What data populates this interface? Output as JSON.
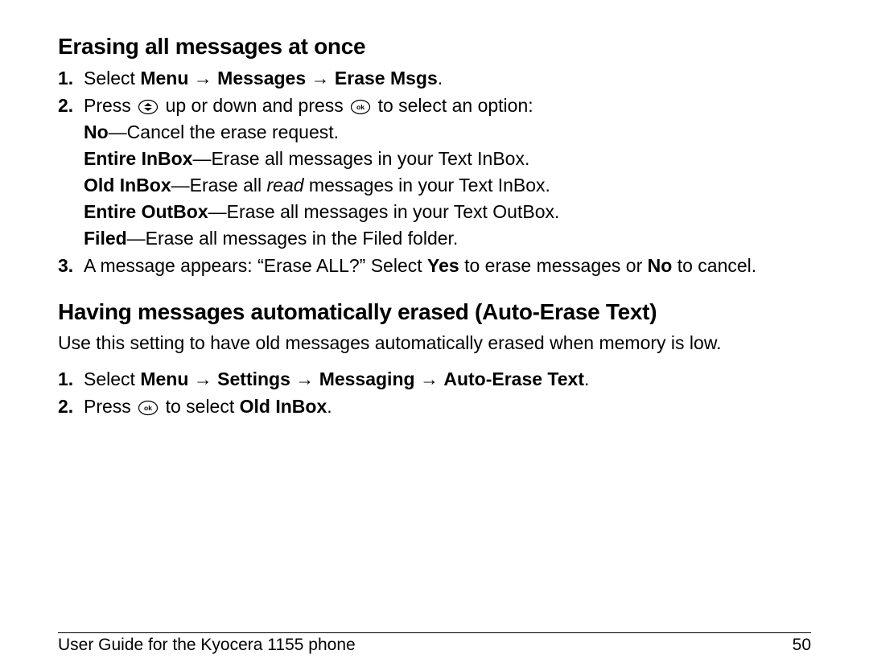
{
  "section1": {
    "heading": "Erasing all messages at once",
    "step1": {
      "num": "1.",
      "select": "Select ",
      "menu": "Menu",
      "arrow": " → ",
      "messages": "Messages",
      "erase": "Erase Msgs",
      "dot": "."
    },
    "step2": {
      "num": "2.",
      "press1": "Press ",
      "mid1": " up or down and press ",
      "mid2": " to select an option:",
      "opts": {
        "no": {
          "b": "No",
          "rest": "—Cancel the erase request."
        },
        "ei": {
          "b": "Entire InBox",
          "rest": "—Erase all messages in your Text InBox."
        },
        "oi": {
          "b": "Old InBox",
          "pre": "—Erase all ",
          "ital": "read",
          "post": " messages in your Text InBox."
        },
        "eo": {
          "b": "Entire OutBox",
          "rest": "—Erase all messages in your Text OutBox."
        },
        "fi": {
          "b": "Filed",
          "rest": "—Erase all messages in the Filed folder."
        }
      }
    },
    "step3": {
      "num": "3.",
      "a": "A message appears: “Erase ALL?” Select ",
      "yes": "Yes",
      "b": " to erase messages or ",
      "no": "No",
      "c": " to cancel."
    }
  },
  "section2": {
    "heading": "Having messages automatically erased (Auto-Erase Text)",
    "intro": "Use this setting to have old messages automatically erased when memory is low.",
    "step1": {
      "num": "1.",
      "select": "Select ",
      "menu": "Menu",
      "arrow": " → ",
      "settings": "Settings",
      "messaging": " Messaging",
      "auto": "Auto-Erase Text",
      "dot": "."
    },
    "step2": {
      "num": "2.",
      "press": "Press ",
      "mid": " to select ",
      "old": "Old InBox",
      "dot": "."
    }
  },
  "footer": {
    "left": "User Guide for the Kyocera 1155 phone",
    "right": "50"
  }
}
